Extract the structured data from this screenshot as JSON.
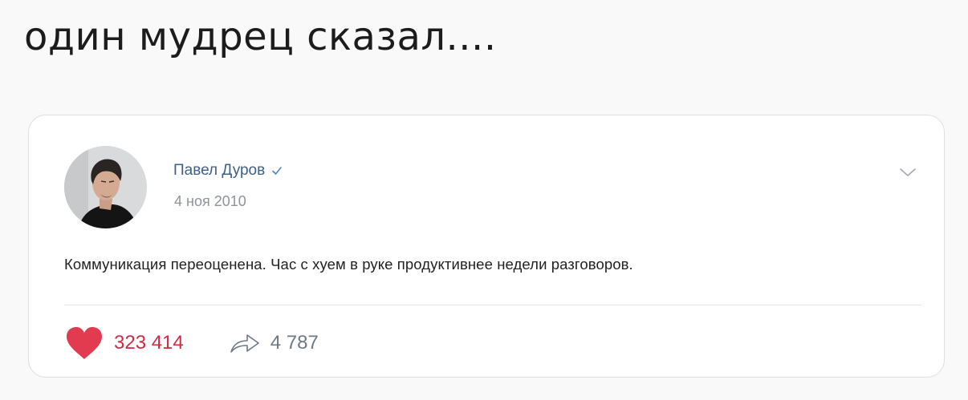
{
  "meme": {
    "caption": "один мудрец сказал...."
  },
  "post": {
    "author": {
      "name": "Павел Дуров",
      "verified": true,
      "avatar_icon": "profile-photo"
    },
    "date": "4 ноя 2010",
    "text": "Коммуникация переоценена. Час с хуем в руке продуктивнее недели разговоров.",
    "actions": {
      "likes": {
        "icon": "heart-icon",
        "count": "323 414",
        "color": "#e23a4f"
      },
      "shares": {
        "icon": "share-arrow-icon",
        "count": "4 787"
      }
    },
    "menu_icon": "chevron-down-icon"
  },
  "colors": {
    "author_link": "#3f5f86",
    "like_red": "#e23a4f",
    "page_background": "#f9f9fa"
  }
}
